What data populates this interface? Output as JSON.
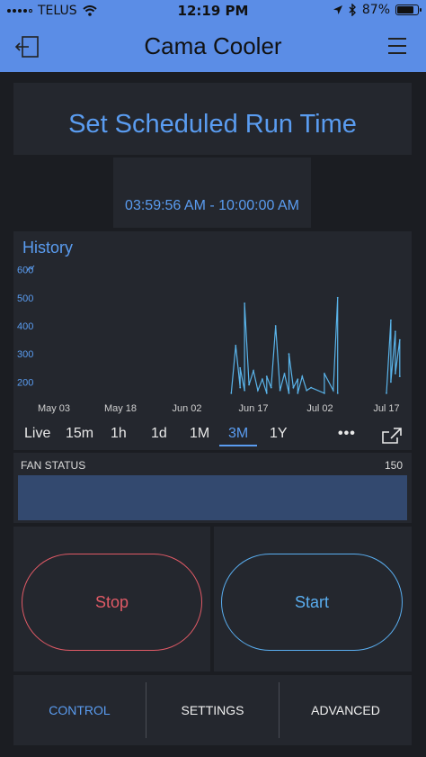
{
  "status_bar": {
    "carrier": "TELUS",
    "time": "12:19 PM",
    "battery": "87%",
    "battery_level": 0.87
  },
  "header": {
    "title": "Cama Cooler"
  },
  "schedule": {
    "title": "Set Scheduled Run Time",
    "time_range": "03:59:56 AM - 10:00:00 AM"
  },
  "history": {
    "title": "History",
    "ranges": [
      "Live",
      "15m",
      "1h",
      "1d",
      "1M",
      "3M",
      "1Y"
    ],
    "selected_range": "3M",
    "more_label": "•••",
    "colors": {
      "line": "#5ab4ea",
      "accent": "#5a9cf0"
    }
  },
  "chart_data": {
    "type": "line",
    "x_ticks": [
      "May 03",
      "May 18",
      "Jun 02",
      "Jun 17",
      "Jul 02",
      "Jul 17"
    ],
    "y_ticks": [
      200,
      300,
      400,
      500,
      600
    ],
    "ylim": [
      150,
      650
    ],
    "series": [
      {
        "points": [
          [
            "Jun 12",
            160
          ],
          [
            "Jun 13",
            330
          ],
          [
            "Jun 14",
            180
          ],
          [
            "Jun 14",
            250
          ],
          [
            "Jun 15",
            170
          ],
          [
            "Jun 15",
            480
          ],
          [
            "Jun 16",
            190
          ],
          [
            "Jun 17",
            240
          ],
          [
            "Jun 18",
            170
          ],
          [
            "Jun 19",
            210
          ],
          [
            "Jun 20",
            160
          ],
          [
            "Jun 20",
            220
          ],
          [
            "Jun 21",
            180
          ],
          [
            "Jun 22",
            400
          ],
          [
            "Jun 23",
            170
          ],
          [
            "Jun 24",
            230
          ],
          [
            "Jun 25",
            160
          ],
          [
            "Jun 25",
            300
          ],
          [
            "Jun 26",
            180
          ],
          [
            "Jun 27",
            210
          ],
          [
            "Jun 27",
            160
          ],
          [
            "Jun 28",
            220
          ],
          [
            "Jun 29",
            170
          ],
          [
            "Jun 30",
            180
          ],
          [
            "Jul 03",
            160
          ],
          [
            "Jul 03",
            230
          ],
          [
            "Jul 05",
            170
          ],
          [
            "Jul 06",
            500
          ],
          [
            "Jul 06",
            160
          ],
          [
            "Jul 17",
            160
          ],
          [
            "Jul 18",
            420
          ],
          [
            "Jul 18",
            200
          ],
          [
            "Jul 19",
            380
          ],
          [
            "Jul 19",
            230
          ],
          [
            "Jul 20",
            350
          ],
          [
            "Jul 20",
            220
          ]
        ]
      }
    ]
  },
  "fan_status": {
    "label": "FAN STATUS",
    "value": "150",
    "color": "#33496f"
  },
  "buttons": {
    "stop": "Stop",
    "start": "Start",
    "stop_color": "#e05a66",
    "start_color": "#5aaef0"
  },
  "tabs": [
    "CONTROL",
    "SETTINGS",
    "ADVANCED"
  ],
  "active_tab": "CONTROL"
}
